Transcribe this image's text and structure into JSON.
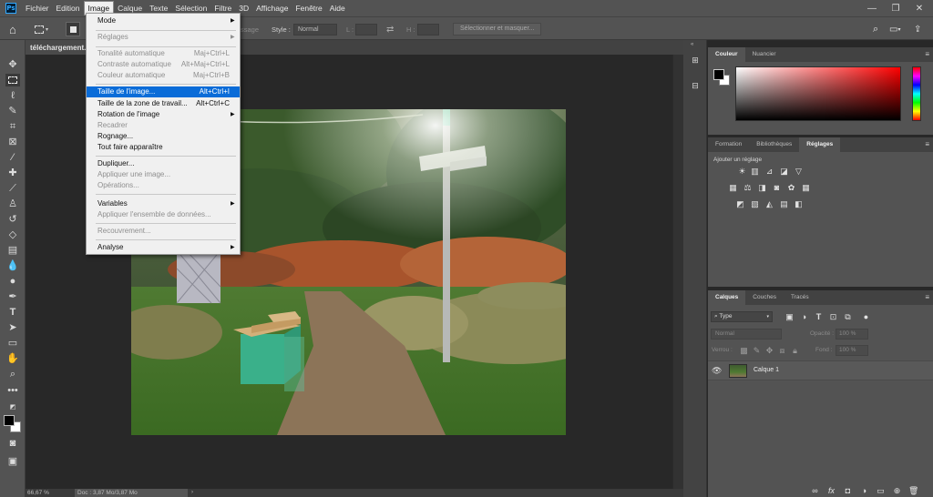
{
  "app": {
    "logo": "Ps"
  },
  "menubar": {
    "items": [
      "Fichier",
      "Edition",
      "Image",
      "Calque",
      "Texte",
      "Sélection",
      "Filtre",
      "3D",
      "Affichage",
      "Fenêtre",
      "Aide"
    ],
    "active": "Image"
  },
  "window_controls": {
    "minimize": "—",
    "maximize": "❐",
    "close": "✕"
  },
  "options_bar": {
    "style_label": "Style :",
    "style_value": "Normal",
    "width_label": "L :",
    "height_label": "H :",
    "select_mask_button": "Sélectionner et masquer...",
    "partial_text": "ssage"
  },
  "document": {
    "tab_title": "téléchargement."
  },
  "image_menu": {
    "items": [
      {
        "label": "Mode",
        "shortcut": "",
        "submenu": true,
        "disabled": false
      },
      {
        "label": "Réglages",
        "shortcut": "",
        "submenu": true,
        "disabled": true
      },
      {
        "label": "Tonalité automatique",
        "shortcut": "Maj+Ctrl+L",
        "submenu": false,
        "disabled": true
      },
      {
        "label": "Contraste automatique",
        "shortcut": "Alt+Maj+Ctrl+L",
        "submenu": false,
        "disabled": true
      },
      {
        "label": "Couleur automatique",
        "shortcut": "Maj+Ctrl+B",
        "submenu": false,
        "disabled": true
      },
      {
        "label": "Taille de l'image...",
        "shortcut": "Alt+Ctrl+I",
        "submenu": false,
        "disabled": false,
        "highlighted": true
      },
      {
        "label": "Taille de la zone de travail...",
        "shortcut": "Alt+Ctrl+C",
        "submenu": false,
        "disabled": false
      },
      {
        "label": "Rotation de l'image",
        "shortcut": "",
        "submenu": true,
        "disabled": false
      },
      {
        "label": "Recadrer",
        "shortcut": "",
        "submenu": false,
        "disabled": true
      },
      {
        "label": "Rognage...",
        "shortcut": "",
        "submenu": false,
        "disabled": false
      },
      {
        "label": "Tout faire apparaître",
        "shortcut": "",
        "submenu": false,
        "disabled": false
      },
      {
        "label": "Dupliquer...",
        "shortcut": "",
        "submenu": false,
        "disabled": false
      },
      {
        "label": "Appliquer une image...",
        "shortcut": "",
        "submenu": false,
        "disabled": true
      },
      {
        "label": "Opérations...",
        "shortcut": "",
        "submenu": false,
        "disabled": true
      },
      {
        "label": "Variables",
        "shortcut": "",
        "submenu": true,
        "disabled": false
      },
      {
        "label": "Appliquer l'ensemble de données...",
        "shortcut": "",
        "submenu": false,
        "disabled": true
      },
      {
        "label": "Recouvrement...",
        "shortcut": "",
        "submenu": false,
        "disabled": true
      },
      {
        "label": "Analyse",
        "shortcut": "",
        "submenu": true,
        "disabled": false
      }
    ]
  },
  "color_panel": {
    "tabs": [
      "Couleur",
      "Nuancier"
    ],
    "active": "Couleur"
  },
  "adjust_panel": {
    "tabs": [
      "Formation",
      "Bibliothèques",
      "Réglages"
    ],
    "active": "Réglages",
    "heading": "Ajouter un réglage"
  },
  "layers_panel": {
    "tabs": [
      "Calques",
      "Couches",
      "Tracés"
    ],
    "active": "Calques",
    "filter_value": "Type",
    "blend_mode": "Normal",
    "opacity_label": "Opacité :",
    "opacity_value": "100 %",
    "lock_label": "Verrou :",
    "fill_label": "Fond :",
    "fill_value": "100 %",
    "layers": [
      {
        "name": "Calque 1",
        "visible": true
      }
    ]
  },
  "status_bar": {
    "zoom": "66,67 %",
    "doc_info": "Doc : 3,87 Mo/3,87 Mo"
  },
  "colors": {
    "ui_bg": "#535353",
    "canvas_bg": "#282828",
    "highlight": "#0a6cd8",
    "foreground_swatch": "#000000",
    "background_swatch": "#ffffff"
  }
}
